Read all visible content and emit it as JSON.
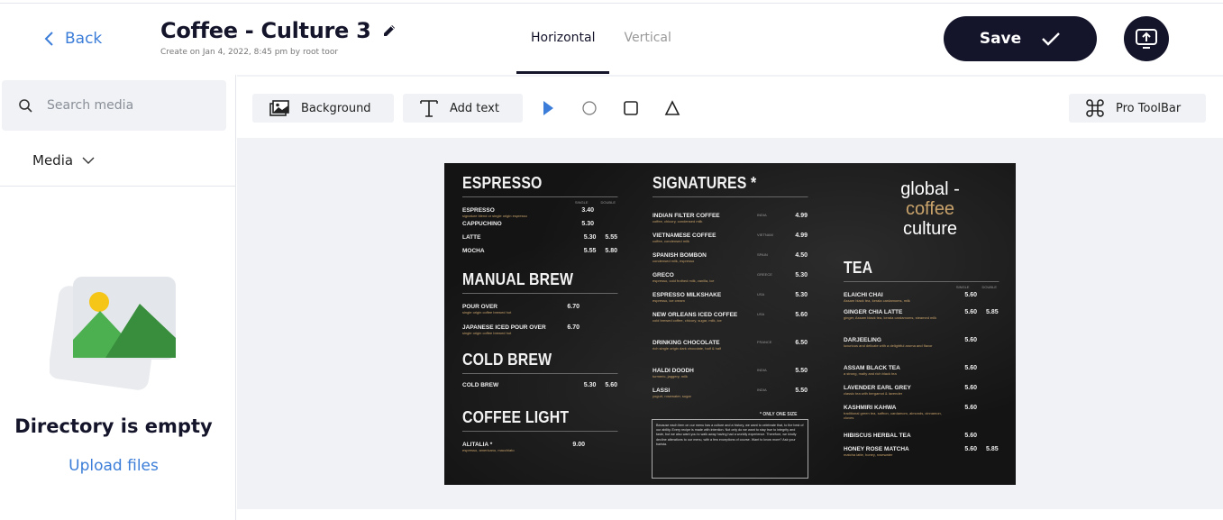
{
  "header": {
    "back_label": "Back",
    "title": "Coffee - Culture 3",
    "subtitle": "Create on Jan 4, 2022, 8:45 pm by root toor",
    "tabs": [
      {
        "label": "Horizontal",
        "active": true
      },
      {
        "label": "Vertical",
        "active": false
      }
    ],
    "save_label": "Save"
  },
  "sidebar": {
    "search_placeholder": "Search media",
    "media_label": "Media",
    "empty_title": "Directory is empty",
    "upload_label": "Upload files"
  },
  "toolbar": {
    "background_label": "Background",
    "add_text_label": "Add text",
    "pro_toolbar_label": "Pro ToolBar"
  },
  "menu": {
    "espresso": {
      "heading": "ESPRESSO",
      "sizes": [
        "SINGLE",
        "DOUBLE"
      ],
      "items": [
        {
          "name": "ESPRESSO",
          "desc": "signature blend or single origin espresso",
          "p1": "3.40",
          "p2": ""
        },
        {
          "name": "CAPPUCHINO",
          "desc": "",
          "p1": "5.30",
          "p2": ""
        },
        {
          "name": "LATTE",
          "desc": "",
          "p1": "5.30",
          "p2": "5.55"
        },
        {
          "name": "MOCHA",
          "desc": "",
          "p1": "5.55",
          "p2": "5.80"
        }
      ]
    },
    "manual_brew": {
      "heading": "MANUAL BREW",
      "items": [
        {
          "name": "POUR OVER",
          "desc": "single origin coffee brewed hot",
          "p1": "6.70"
        },
        {
          "name": "JAPANESE ICED POUR OVER",
          "desc": "single origin coffee brewed hot",
          "p1": "6.70"
        }
      ]
    },
    "cold_brew": {
      "heading": "COLD BREW",
      "items": [
        {
          "name": "COLD BREW",
          "p1": "5.30",
          "p2": "5.60"
        }
      ]
    },
    "coffee_light": {
      "heading": "COFFEE LIGHT",
      "items": [
        {
          "name": "ALITALIA *",
          "desc": "espresso, americano, macchiato",
          "p1": "9.00"
        }
      ]
    },
    "signatures": {
      "heading": "SIGNATURES *",
      "items": [
        {
          "name": "INDIAN FILTER COFFEE",
          "desc": "coffee, chicory, condensed milk",
          "origin": "INDIA",
          "price": "4.99"
        },
        {
          "name": "VIETNAMESE COFFEE",
          "desc": "coffee, condensed milk",
          "origin": "VIETNAM",
          "price": "4.99"
        },
        {
          "name": "SPANISH BOMBON",
          "desc": "condensed milk, espresso",
          "origin": "SPAIN",
          "price": "4.50"
        },
        {
          "name": "GRECO",
          "desc": "espresso, cold frothed milk, vanilla, ice",
          "origin": "GREECE",
          "price": "5.30"
        },
        {
          "name": "ESPRESSO MILKSHAKE",
          "desc": "espresso, ice cream",
          "origin": "USA",
          "price": "5.30"
        },
        {
          "name": "NEW ORLEANS ICED COFFEE",
          "desc": "cold brewed coffee, chicory, sugar, milk, ice",
          "origin": "USA",
          "price": "5.60"
        },
        {
          "name": "DRINKING CHOCOLATE",
          "desc": "rich single origin dark chocolate, half & half",
          "origin": "FRANCE",
          "price": "6.50"
        },
        {
          "name": "HALDI DOODH",
          "desc": "turmeric, jaggery, milk",
          "origin": "INDIA",
          "price": "5.50"
        },
        {
          "name": "LASSI",
          "desc": "yogurt, rosewater, sugar",
          "origin": "INDIA",
          "price": "5.50"
        }
      ],
      "only_one": "* ONLY ONE SIZE",
      "note": "Because each item on our menu has a culture and a history, we want to celebrate that, to the best of our ability. Every recipe is made with intention. Not only do we want to stay true to integrity and taste, but we also want you to walk away having had a worldly experience. Therefore, we kindly decline alterations to our menu, with a few exceptions of course. Want to know more? Ask your barista."
    },
    "brand": {
      "line1": "global -",
      "line2": "coffee",
      "line3": "culture"
    },
    "tea": {
      "heading": "TEA",
      "sizes": [
        "SINGLE",
        "DOUBLE"
      ],
      "items": [
        {
          "name": "ELAICHI CHAI",
          "desc": "Assam black tea, kerala cardamoms, milk",
          "p1": "5.60",
          "p2": ""
        },
        {
          "name": "GINGER CHIA LATTE",
          "desc": "ginger, Assam black tea, kerala cardamoms, steamed milk",
          "p1": "5.60",
          "p2": "5.85"
        },
        {
          "name": "DARJEELING",
          "desc": "luxurious and delicate with a delightful aroma and flavor",
          "p1": "5.60",
          "p2": ""
        },
        {
          "name": "ASSAM BLACK TEA",
          "desc": "a strong, malty and rich black tea",
          "p1": "5.60",
          "p2": ""
        },
        {
          "name": "LAVENDER EARL GREY",
          "desc": "classic tea with bergamot & lavender",
          "p1": "5.60",
          "p2": ""
        },
        {
          "name": "KASHMIRI KAHWA",
          "desc": "traditional green tea, saffron, cardamom, almonds, cinnamon, cloves",
          "p1": "5.60",
          "p2": ""
        },
        {
          "name": "HIBISCUS HERBAL TEA",
          "desc": "",
          "p1": "5.60",
          "p2": ""
        },
        {
          "name": "HONEY ROSE MATCHA",
          "desc": "matcha latte, honey, rosewater",
          "p1": "5.60",
          "p2": "5.85"
        }
      ]
    }
  }
}
